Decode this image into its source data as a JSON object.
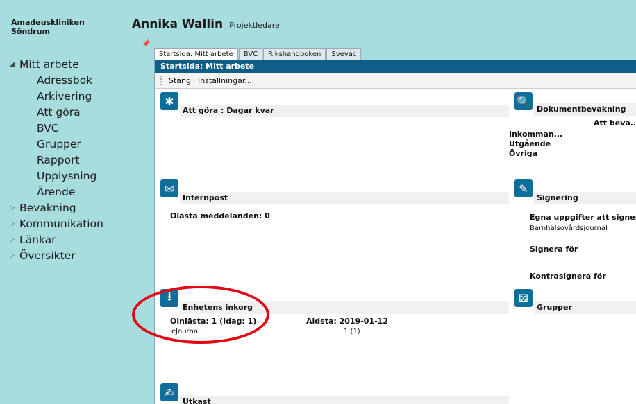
{
  "clinic": {
    "line1": "Amadeuskliniken",
    "line2": "Söndrum"
  },
  "user": {
    "name": "Annika Wallin",
    "role": "Projektledare"
  },
  "nav": {
    "mitt_arbete": "Mitt arbete",
    "sub": [
      "Adressbok",
      "Arkivering",
      "Att göra",
      "BVC",
      "Grupper",
      "Rapport",
      "Upplysning",
      "Ärende"
    ],
    "groups": [
      "Bevakning",
      "Kommunikation",
      "Länkar",
      "Översikter"
    ]
  },
  "tabs": [
    "Startsida: Mitt arbete",
    "BVC",
    "Rikshandboken",
    "Svevac"
  ],
  "panel": {
    "title": "Startsida: Mitt arbete",
    "close": "Stäng",
    "settings": "Inställningar..."
  },
  "widgets": {
    "todo": {
      "title": "Att göra : Dagar kvar"
    },
    "docwatch": {
      "title": "Dokumentbevakning",
      "col": "Att beva...",
      "rows": [
        "Inkomman...",
        "Utgående",
        "Övriga"
      ]
    },
    "mail": {
      "title": "Internpost",
      "unread": "Olästa meddelanden: 0"
    },
    "sign": {
      "title": "Signering",
      "own": "Egna uppgifter att signera",
      "bhv": "Barnhälsovårdsjournal",
      "for": "Signera för",
      "counter": "Kontrasignera för"
    },
    "inbox": {
      "title": "Enhetens inkorg",
      "loaded": "Oinlästa: 1 (Idag: 1)",
      "oldest": "Äldsta: 2019-01-12",
      "source": "eJournal:",
      "count": "1 (1)"
    },
    "groups": {
      "title": "Grupper"
    },
    "drafts": {
      "title": "Utkast"
    }
  },
  "colors": {
    "background": "#a8dde0",
    "panel_header": "#0e5e87",
    "icon": "#0f6e99",
    "highlight": "#e30613"
  }
}
